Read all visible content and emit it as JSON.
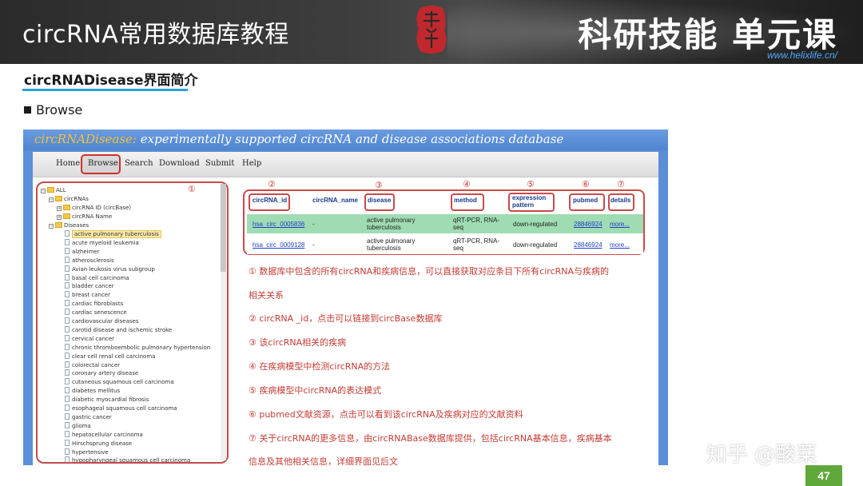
{
  "banner": {
    "title": "circRNA常用数据库教程",
    "right_title": "科研技能 单元课",
    "url": "www.helixlife.cn/"
  },
  "section": {
    "title": "circRNADisease界面简介",
    "subheading": "Browse"
  },
  "site": {
    "brand_name": "circRNADisease:",
    "brand_tagline": " experimentally supported circRNA and disease associations database",
    "nav": [
      "Home",
      "Browse",
      "Search",
      "Download",
      "Submit",
      "Help"
    ]
  },
  "markers": [
    "①",
    "②",
    "③",
    "④",
    "⑤",
    "⑥",
    "⑦"
  ],
  "tree": {
    "root": "ALL",
    "circrnas": "circRNAs",
    "circrna_children": [
      "circRNA ID (circBase)",
      "circRNA Name"
    ],
    "diseases_label": "Diseases",
    "diseases": [
      "active pulmonary tuberculosis",
      "acute myeloid leukemia",
      "alzheimer",
      "atherosclerosis",
      "Avian leukosis virus subgroup",
      "basal cell carcinoma",
      "bladder cancer",
      "breast cancer",
      "cardiac fibroblasts",
      "cardiac senescence",
      "cardiovascular diseases",
      "carotid disease and ischemic stroke",
      "cervical cancer",
      "chronic thromboembolic pulmonary hypertension",
      "clear cell renal cell carcinoma",
      "colorectal cancer",
      "coronary artery disease",
      "cutaneous squamous cell carcinoma",
      "diabetes mellitus",
      "diabetic myocardial fibrosis",
      "esophageal squamous cell carcinoma",
      "gastric cancer",
      "glioma",
      "hepatocellular carcinoma",
      "Hirschsprung disease",
      "hypertensive",
      "hypopharyngeal squamous cell carcinoma"
    ]
  },
  "table": {
    "headers": [
      "circRNA_id",
      "circRNA_name",
      "disease",
      "method",
      "expression pattern",
      "pubmed",
      "details"
    ],
    "rows": [
      [
        "hsa_circ_0005836",
        "-",
        "active pulmonary tuberculosis",
        "qRT-PCR, RNA-seq",
        "down-regulated",
        "28846924",
        "more..."
      ],
      [
        "hsa_circ_0009128",
        "-",
        "active pulmonary tuberculosis",
        "qRT-PCR, RNA-seq",
        "down-regulated",
        "28846924",
        "more..."
      ]
    ]
  },
  "notes": [
    "① 数据库中包含的所有circRNA和疾病信息，可以直接获取对应条目下所有circRNA与疾病的",
    "相关关系",
    "② circRNA _id，点击可以链接到circBase数据库",
    "③ 该circRNA相关的疾病",
    "④ 在疾病模型中检测circRNA的方法",
    "⑤ 疾病模型中circRNA的表达模式",
    "⑥ pubmed文献资源，点击可以看到该circRNA及疾病对应的文献资料",
    "⑦ 关于circRNA的更多信息，由circRNABase数据库提供，包括circRNA基本信息，疾病基本",
    "信息及其他相关信息，详细界面见后文"
  ],
  "watermark": "知乎 @酸菜",
  "page_number": "47",
  "colors": {
    "accent_red": "#c43c35",
    "underline_blue": "#2aa0d8",
    "row_green": "#9fdcb3",
    "page_badge": "#5fa83a"
  }
}
